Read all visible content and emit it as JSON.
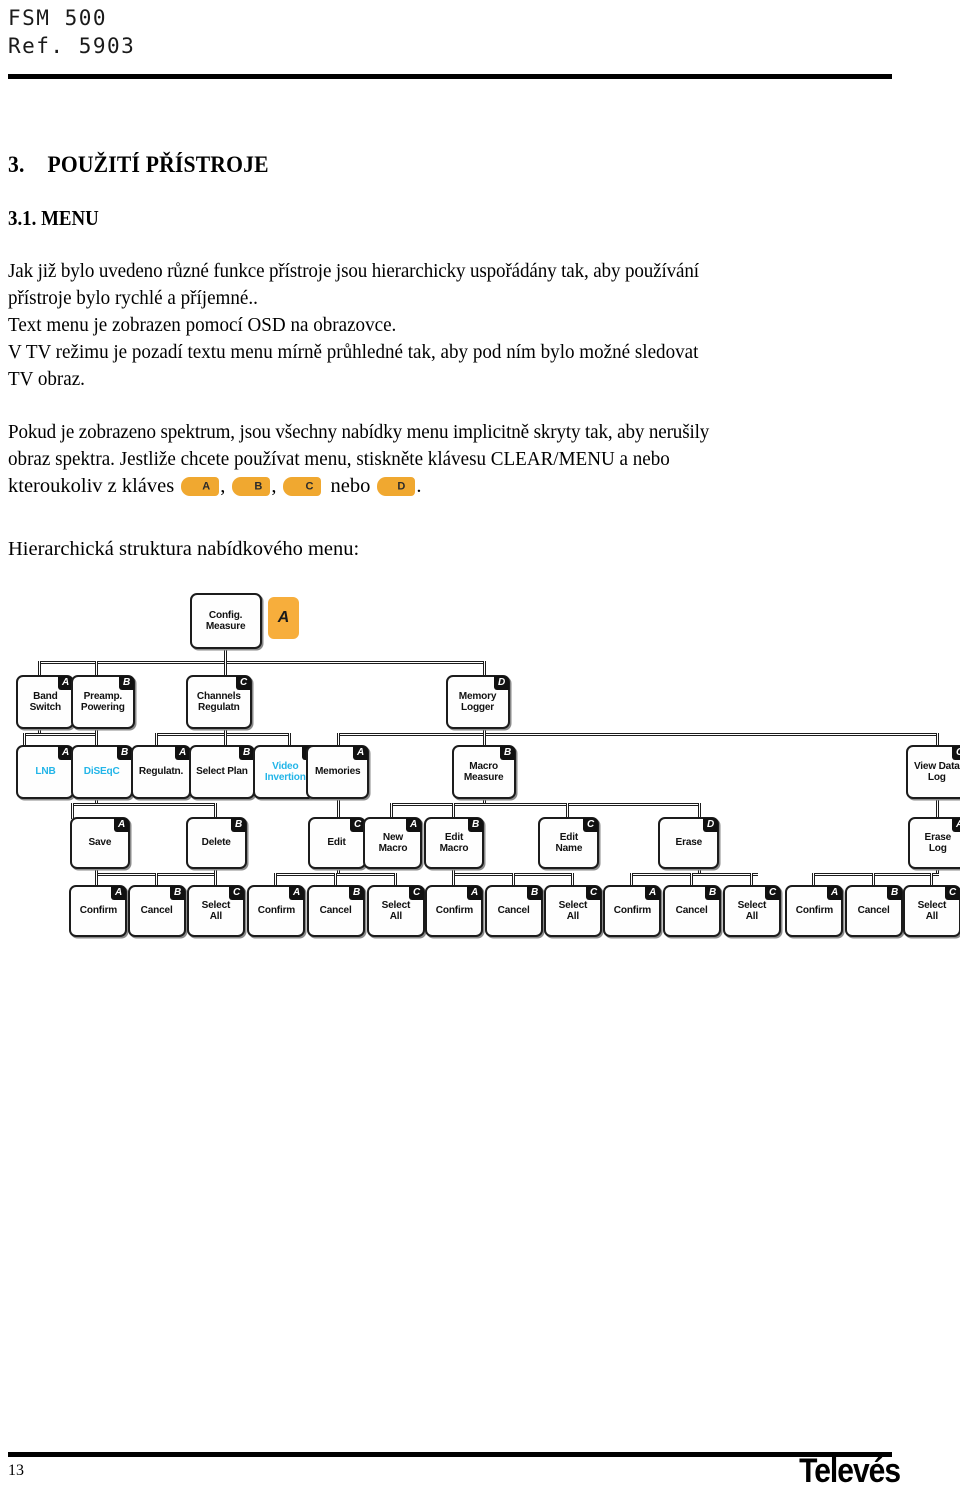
{
  "header": {
    "model": "FSM 500",
    "reference": "Ref. 5903"
  },
  "headings": {
    "section_number": "3.",
    "section_title": "POUŽITÍ PŘÍSTROJE",
    "subsection": "3.1. MENU"
  },
  "body": {
    "p1_line1": "Jak již bylo uvedeno různé funkce přístroje jsou hierarchicky uspořádány tak, aby používání",
    "p1_line2": "přístroje bylo rychlé a příjemné..",
    "p1_line3": "Text menu je zobrazen pomocí OSD na obrazovce.",
    "p1_line4": "V TV režimu je pozadí textu menu mírně průhledné tak, aby pod ním bylo možné sledovat",
    "p1_line5": "TV obraz.",
    "p2_line1": "Pokud je zobrazeno spektrum, jsou všechny nabídky menu implicitně skryty tak, aby nerušily",
    "p2_line2": "obraz spektra. Jestliže chcete používat menu, stiskněte klávesu CLEAR/MENU a nebo",
    "p2_line3_pre": "kteroukoliv z kláves",
    "p2_sep1": ",",
    "p2_sep2": ",",
    "p2_mid": "nebo",
    "p2_end": ".",
    "keys": [
      "A",
      "B",
      "C",
      "D"
    ],
    "caption": "Hierarchická struktura nabídkového menu:"
  },
  "colors": {
    "key_orange": "#f0a830",
    "node_cyan": "#23b5e8",
    "badge_black": "#111111"
  },
  "diagram": {
    "root": {
      "label_line1": "Config.",
      "label_line2": "Measure",
      "key": "A"
    },
    "root_chip": {
      "letter": "A"
    },
    "level2": [
      {
        "label_line1": "Band",
        "label_line2": "Switch",
        "key": "A"
      },
      {
        "label_line1": "Preamp.",
        "label_line2": "Powering",
        "key": "B"
      },
      {
        "label_line1": "Channels",
        "label_line2": "Regulatn",
        "key": "C"
      },
      {
        "label_line1": "Memory",
        "label_line2": "Logger",
        "key": "D"
      }
    ],
    "level3": [
      {
        "label_line1": "LNB",
        "label_line2": "",
        "key": "A",
        "cyan": true
      },
      {
        "label_line1": "DiSEqC",
        "label_line2": "",
        "key": "B",
        "cyan": true
      },
      {
        "label_line1": "Regulatn.",
        "label_line2": "",
        "key": "A",
        "cyan": false
      },
      {
        "label_line1": "Select Plan",
        "label_line2": "",
        "key": "B",
        "cyan": false
      },
      {
        "label_line1": "Video",
        "label_line2": "Invertion",
        "key": "C",
        "cyan": true
      },
      {
        "label_line1": "Memories",
        "label_line2": "",
        "key": "A",
        "cyan": false
      },
      {
        "label_line1": "Macro",
        "label_line2": "Measure",
        "key": "B",
        "cyan": false
      },
      {
        "label_line1": "View Data",
        "label_line2": "Log",
        "key": "C",
        "cyan": false
      }
    ],
    "level4": [
      {
        "label_line1": "Save",
        "label_line2": "",
        "key": "A"
      },
      {
        "label_line1": "Delete",
        "label_line2": "",
        "key": "B"
      },
      {
        "label_line1": "Edit",
        "label_line2": "",
        "key": "C"
      },
      {
        "label_line1": "New",
        "label_line2": "Macro",
        "key": "A"
      },
      {
        "label_line1": "Edit",
        "label_line2": "Macro",
        "key": "B"
      },
      {
        "label_line1": "Edit",
        "label_line2": "Name",
        "key": "C"
      },
      {
        "label_line1": "Erase",
        "label_line2": "",
        "key": "D"
      },
      {
        "label_line1": "Erase",
        "label_line2": "Log",
        "key": "A"
      }
    ],
    "level5": [
      {
        "label_line1": "Confirm",
        "label_line2": "",
        "key": "A"
      },
      {
        "label_line1": "Cancel",
        "label_line2": "",
        "key": "B"
      },
      {
        "label_line1": "Select",
        "label_line2": "All",
        "key": "C"
      },
      {
        "label_line1": "Confirm",
        "label_line2": "",
        "key": "A"
      },
      {
        "label_line1": "Cancel",
        "label_line2": "",
        "key": "B"
      },
      {
        "label_line1": "Select",
        "label_line2": "All",
        "key": "C"
      },
      {
        "label_line1": "Confirm",
        "label_line2": "",
        "key": "A"
      },
      {
        "label_line1": "Cancel",
        "label_line2": "",
        "key": "B"
      },
      {
        "label_line1": "Select",
        "label_line2": "All",
        "key": "C"
      },
      {
        "label_line1": "Confirm",
        "label_line2": "",
        "key": "A"
      },
      {
        "label_line1": "Cancel",
        "label_line2": "",
        "key": "B"
      },
      {
        "label_line1": "Select",
        "label_line2": "All",
        "key": "C"
      },
      {
        "label_line1": "Confirm",
        "label_line2": "",
        "key": "A"
      },
      {
        "label_line1": "Cancel",
        "label_line2": "",
        "key": "B"
      },
      {
        "label_line1": "Select",
        "label_line2": "All",
        "key": "C"
      }
    ]
  },
  "footer": {
    "page_number": "13",
    "brand": "Televés"
  }
}
